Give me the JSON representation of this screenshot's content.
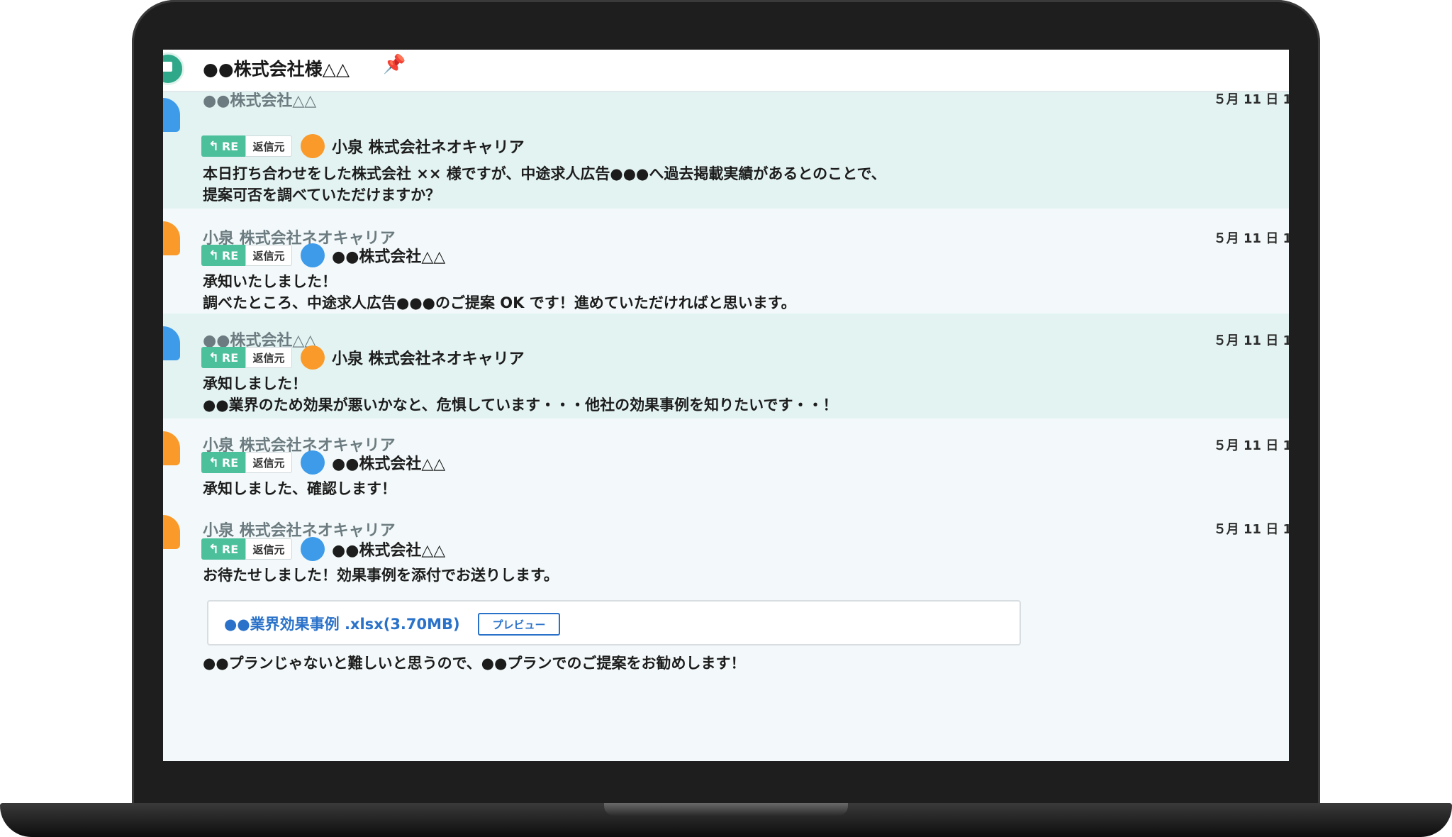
{
  "header": {
    "title": "●●株式会社様△△",
    "pin_icon": "pin-icon",
    "app_icon": "chat-app-icon"
  },
  "labels": {
    "re": "RE",
    "source": "返信元"
  },
  "messages": [
    {
      "sender": "●●株式会社△△",
      "time": "５月 11 日 1",
      "reply_to": "小泉 株式会社ネオキャリア",
      "lines": [
        "本日打ち合わせをした株式会社 ×× 様ですが、中途求人広告●●●へ過去掲載実績があるとのことで、",
        "提案可否を調べていただけますか？"
      ]
    },
    {
      "sender": "小泉 株式会社ネオキャリア",
      "time": "５月 11 日 1",
      "reply_to": "●●株式会社△△",
      "lines": [
        "承知いたしました！",
        "調べたところ、中途求人広告●●●のご提案 OK です！進めていただければと思います。"
      ]
    },
    {
      "sender": "●●株式会社△△",
      "time": "５月 11 日 1",
      "reply_to": "小泉 株式会社ネオキャリア",
      "lines": [
        "承知しました！",
        "●●業界のため効果が悪いかなと、危惧しています・・・他社の効果事例を知りたいです・・！"
      ]
    },
    {
      "sender": "小泉 株式会社ネオキャリア",
      "time": "５月 11 日 1",
      "reply_to": "●●株式会社△△",
      "lines": [
        "承知しました、確認します！"
      ]
    },
    {
      "sender": "小泉 株式会社ネオキャリア",
      "time": "５月 11 日 1",
      "reply_to": "●●株式会社△△",
      "lines": [
        "お待たせしました！効果事例を添付でお送りします。"
      ],
      "attachment": {
        "filename": "●●業界効果事例 .xlsx(3.70MB)",
        "preview_label": "プレビュー"
      },
      "trailing_line": "●●プランじゃないと難しいと思うので、●●プランでのご提案をお勧めします！"
    }
  ],
  "colors": {
    "accent_green": "#4cbf9b",
    "avatar_blue": "#3d9be9",
    "avatar_orange": "#f99a2a",
    "link_blue": "#2a72c9",
    "tint_row": "#e3f3f2"
  }
}
